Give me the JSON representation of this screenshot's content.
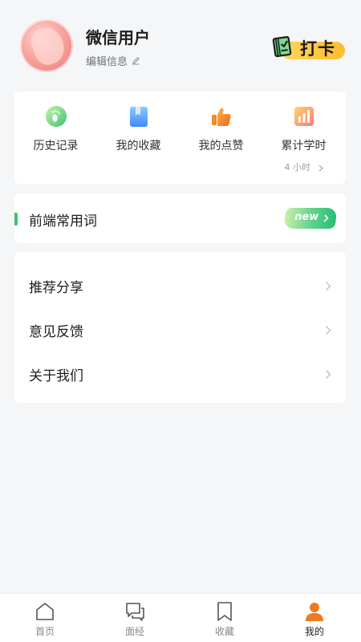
{
  "profile": {
    "name": "微信用户",
    "edit_label": "编辑信息",
    "avatar_icon": "avatar-image"
  },
  "checkin": {
    "label": "打卡",
    "icon": "book-icon",
    "color": "#ffc93c"
  },
  "stats": [
    {
      "label": "历史记录",
      "icon": "footprint-icon",
      "sub": ""
    },
    {
      "label": "我的收藏",
      "icon": "bookmark-book-icon",
      "sub": ""
    },
    {
      "label": "我的点赞",
      "icon": "thumbs-up-icon",
      "sub": ""
    },
    {
      "label": "累计学时",
      "icon": "bar-chart-icon",
      "sub": "4 小时"
    }
  ],
  "vocab": {
    "title": "前端常用词",
    "badge": "new",
    "accent": "#3fc27a"
  },
  "menu": [
    {
      "label": "推荐分享"
    },
    {
      "label": "意见反馈"
    },
    {
      "label": "关于我们"
    }
  ],
  "tabbar": {
    "active": "我的",
    "accent": "#f07a20",
    "tabs": [
      {
        "label": "首页",
        "icon": "home-icon"
      },
      {
        "label": "面经",
        "icon": "chat-icon"
      },
      {
        "label": "收藏",
        "icon": "bookmark-icon"
      },
      {
        "label": "我的",
        "icon": "user-icon"
      }
    ]
  }
}
